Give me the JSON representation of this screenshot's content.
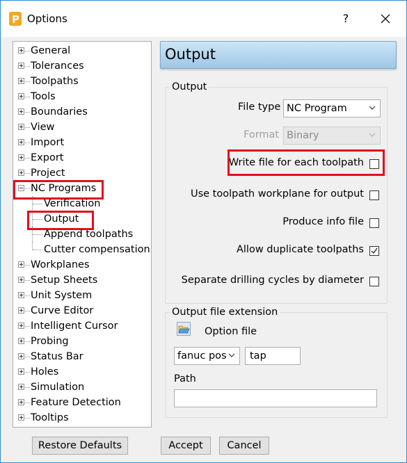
{
  "window": {
    "title": "Options",
    "help_label": "?"
  },
  "tree": {
    "items": [
      {
        "label": "General",
        "expander": "plus"
      },
      {
        "label": "Tolerances",
        "expander": "plus"
      },
      {
        "label": "Toolpaths",
        "expander": "plus"
      },
      {
        "label": "Tools",
        "expander": "plus"
      },
      {
        "label": "Boundaries",
        "expander": "plus"
      },
      {
        "label": "View",
        "expander": "plus"
      },
      {
        "label": "Import",
        "expander": "plus"
      },
      {
        "label": "Export",
        "expander": "plus"
      },
      {
        "label": "Project",
        "expander": "plus"
      },
      {
        "label": "NC Programs",
        "expander": "minus",
        "highlighted": true
      },
      {
        "label": "Verification",
        "child": true
      },
      {
        "label": "Output",
        "child": true,
        "selected": true,
        "highlighted": true
      },
      {
        "label": "Append toolpaths",
        "child": true
      },
      {
        "label": "Cutter compensation",
        "child": true
      },
      {
        "label": "Workplanes",
        "expander": "plus"
      },
      {
        "label": "Setup Sheets",
        "expander": "plus"
      },
      {
        "label": "Unit System",
        "expander": "plus"
      },
      {
        "label": "Curve Editor",
        "expander": "plus"
      },
      {
        "label": "Intelligent Cursor",
        "expander": "plus"
      },
      {
        "label": "Probing",
        "expander": "plus"
      },
      {
        "label": "Status Bar",
        "expander": "plus"
      },
      {
        "label": "Holes",
        "expander": "plus"
      },
      {
        "label": "Simulation",
        "expander": "plus"
      },
      {
        "label": "Feature Detection",
        "expander": "plus"
      },
      {
        "label": "Tooltips",
        "expander": "plus"
      }
    ]
  },
  "panel": {
    "header": "Output",
    "output_group": {
      "title": "Output",
      "file_type_label": "File type",
      "file_type_value": "NC Program",
      "format_label": "Format",
      "format_value": "Binary",
      "options": [
        {
          "label": "Write file for each toolpath",
          "checked": false,
          "highlighted": true
        },
        {
          "label": "Use toolpath workplane for output",
          "checked": false
        },
        {
          "label": "Produce info file",
          "checked": false
        },
        {
          "label": "Allow duplicate toolpaths",
          "checked": true
        },
        {
          "label": "Separate drilling cycles by diameter",
          "checked": false
        }
      ]
    },
    "extension_group": {
      "title": "Output file extension",
      "option_file_label": "Option file",
      "option_file_select": "fanuc pos",
      "extension_value": "tap",
      "path_label": "Path",
      "path_value": ""
    }
  },
  "buttons": {
    "restore_defaults": "Restore Defaults",
    "accept": "Accept",
    "cancel": "Cancel"
  },
  "colors": {
    "highlight_red": "#e0101c",
    "header_blue": "#9ec7e6",
    "app_icon": "#f5a623"
  }
}
